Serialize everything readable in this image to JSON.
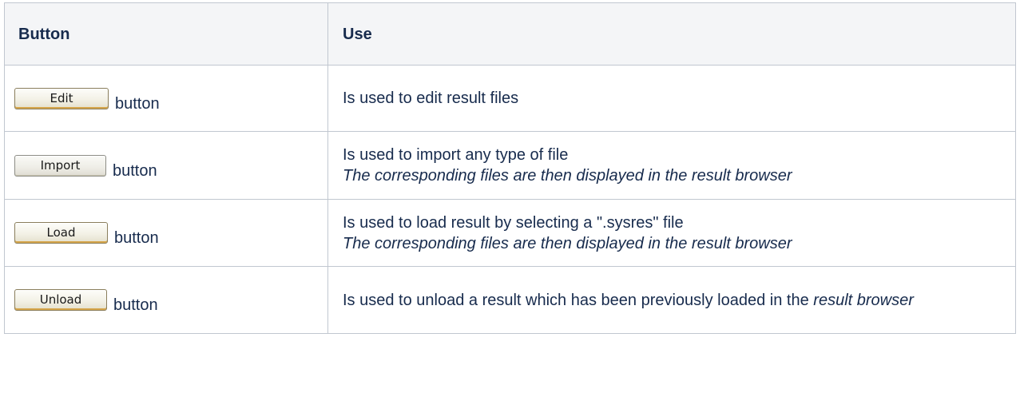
{
  "table": {
    "headers": {
      "button": "Button",
      "use": "Use"
    },
    "rows": [
      {
        "button_label": "Edit",
        "button_word": "button",
        "use_line1": "Is used to edit result files",
        "use_line2": ""
      },
      {
        "button_label": "Import",
        "button_word": "button",
        "use_line1": "Is used to import any type of file",
        "use_line2": "The corresponding files are then displayed in the result browser"
      },
      {
        "button_label": "Load",
        "button_word": "button",
        "use_line1": "Is used to load result by selecting a \".sysres\" file",
        "use_line2": "The corresponding files are then displayed in the result browser"
      },
      {
        "button_label": "Unload",
        "button_word": "button",
        "use_text": "Is used to unload a result which has been previously loaded in the ",
        "use_emph": "result browser"
      }
    ]
  }
}
